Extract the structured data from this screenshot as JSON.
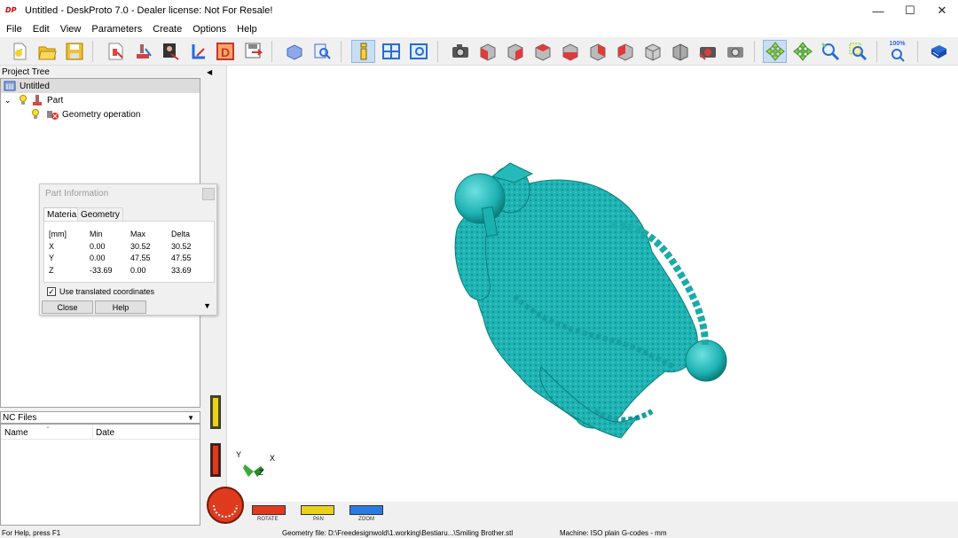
{
  "window": {
    "title": "Untitled - DeskProto 7.0 - Dealer license: Not For Resale!",
    "minimize": "—",
    "maximize": "☐",
    "close": "✕",
    "logo_text": "DP"
  },
  "menu": [
    "File",
    "Edit",
    "View",
    "Parameters",
    "Create",
    "Options",
    "Help"
  ],
  "toolbar": {
    "icons": [
      "new-project-icon",
      "open-project-icon",
      "save-project-icon",
      "part-load-icon",
      "part-parameters-icon",
      "bitmap-icon",
      "vector-icon",
      "drawing-icon",
      "save-nc-icon",
      "fit-view-icon",
      "measure-icon",
      "info-icon",
      "layout-icon",
      "graphics-icon",
      "camera-icon",
      "view-front-icon",
      "view-top-icon",
      "view-right-icon",
      "view-left-icon",
      "view-bottom-icon",
      "view-back-icon",
      "view-iso-icon",
      "view-iso2-icon",
      "record-icon",
      "snapshot-icon",
      "rotate-tool-icon",
      "pan-tool-icon",
      "zoom-in-icon",
      "zoom-window-icon",
      "zoom-100-icon",
      "help-book-icon"
    ],
    "zoom_label": "100%"
  },
  "project_tree": {
    "label": "Project Tree",
    "root": "Untitled",
    "part": "Part",
    "operation": "Geometry operation"
  },
  "nc_files": {
    "label": "NC Files",
    "col_name": "Name",
    "col_date": "Date"
  },
  "part_info": {
    "title": "Part Information",
    "tabs": [
      "Material",
      "Geometry"
    ],
    "headers": [
      "[mm]",
      "Min",
      "Max",
      "Delta"
    ],
    "rows": [
      {
        "axis": "X",
        "min": "0.00",
        "max": "30.52",
        "delta": "30.52"
      },
      {
        "axis": "Y",
        "min": "0.00",
        "max": "47.55",
        "delta": "47.55"
      },
      {
        "axis": "Z",
        "min": "-33.69",
        "max": "0.00",
        "delta": "33.69"
      }
    ],
    "checkbox_label": "Use translated coordinates",
    "checkbox_checked": true,
    "close_label": "Close",
    "help_label": "Help"
  },
  "axis_labels": {
    "x": "X",
    "y": "Y",
    "z": "Z"
  },
  "modes": {
    "rotate": "ROTATE",
    "pan": "PAN",
    "zoom": "ZOOM"
  },
  "status": {
    "help": "For Help, press F1",
    "geometry_file": "Geometry file: D:\\Freedesignwold\\1.working\\Bestiaru...\\Smiling Brother.stl",
    "machine": "Machine: ISO plain G-codes - mm"
  },
  "colors": {
    "model": "#1fb5b5",
    "model_dark": "#0d7f7f",
    "rotate": "#e03a1e",
    "pan": "#e0c21e",
    "zoom": "#2a7be0"
  }
}
